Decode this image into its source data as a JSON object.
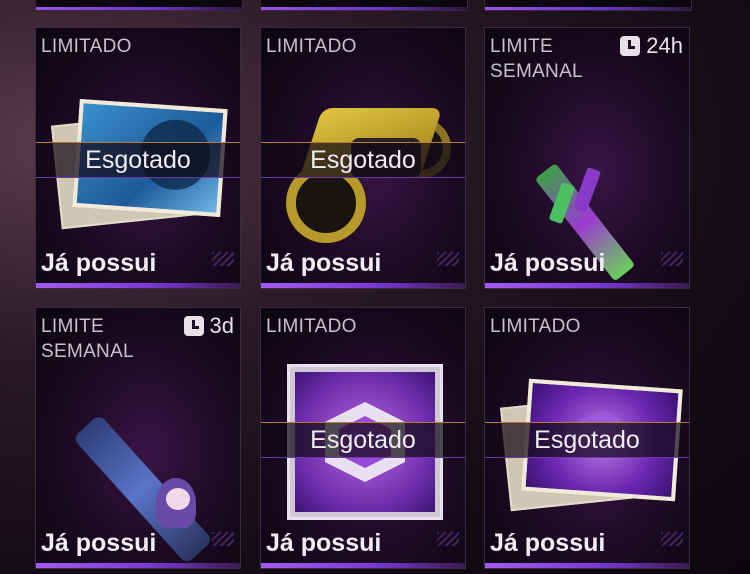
{
  "cards": [
    {
      "tag": "LIMITADO",
      "timer": "",
      "status": "Esgotado",
      "owned": "Já possui"
    },
    {
      "tag": "LIMITADO",
      "timer": "",
      "status": "Esgotado",
      "owned": "Já possui"
    },
    {
      "tag": "LIMITE\nSEMANAL",
      "timer": "24h",
      "status": "",
      "owned": "Já possui"
    },
    {
      "tag": "LIMITE\nSEMANAL",
      "timer": "3d",
      "status": "",
      "owned": "Já possui"
    },
    {
      "tag": "LIMITADO",
      "timer": "",
      "status": "Esgotado",
      "owned": "Já possui"
    },
    {
      "tag": "LIMITADO",
      "timer": "",
      "status": "Esgotado",
      "owned": "Já possui"
    }
  ],
  "colors": {
    "accent": "#9a52e8",
    "sold_border": "#b8793a"
  }
}
